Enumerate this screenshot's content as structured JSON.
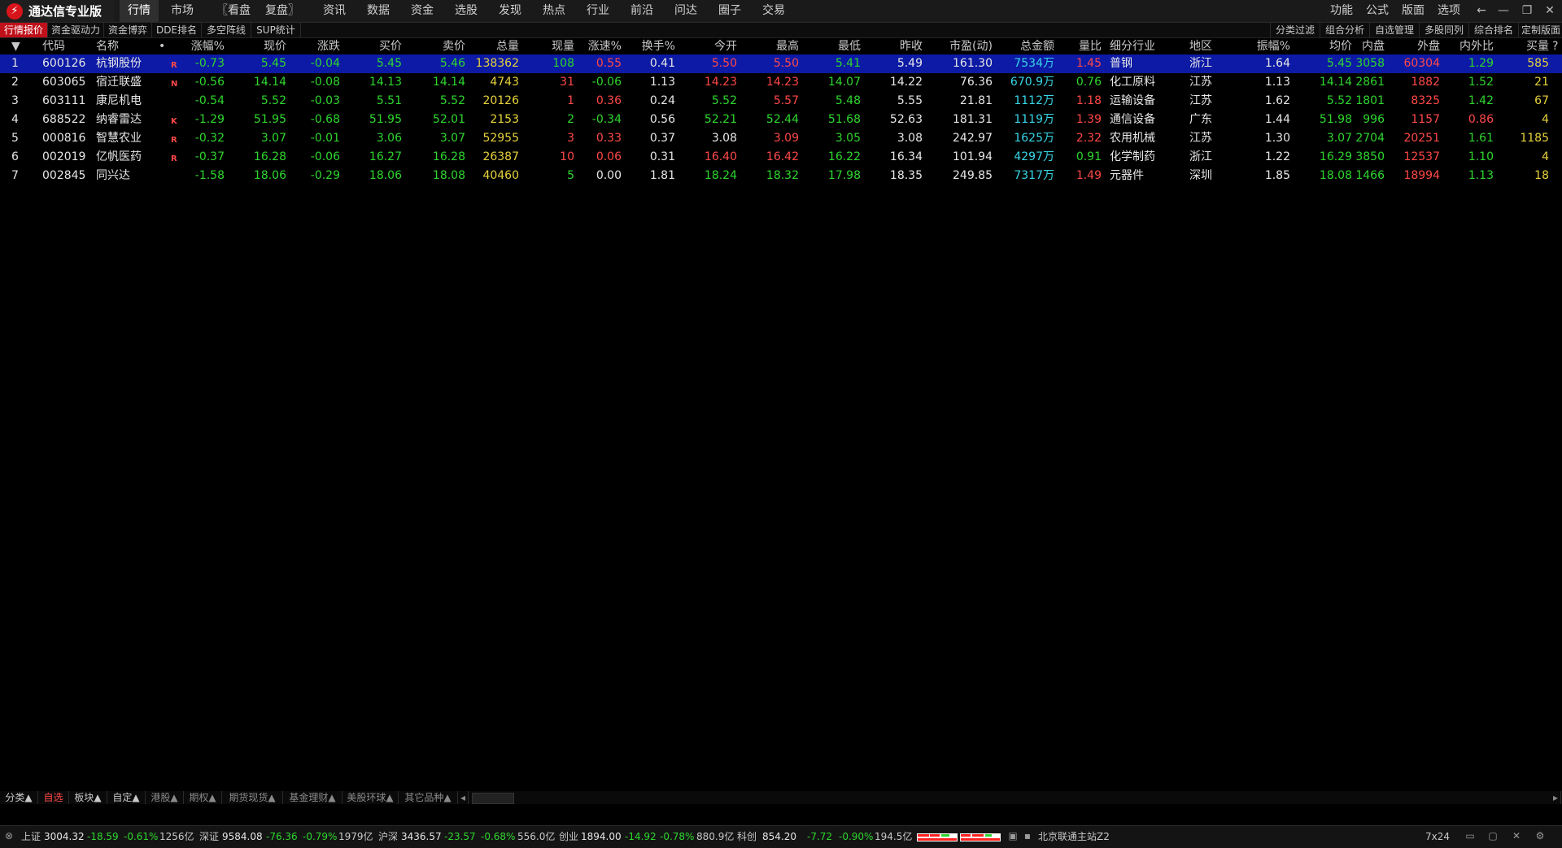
{
  "app": {
    "title": "通达信专业版"
  },
  "menu": {
    "items": [
      "行情",
      "市场",
      "〖看盘",
      "复盘〗",
      "资讯",
      "数据",
      "资金",
      "选股",
      "发现",
      "热点",
      "行业",
      "前沿",
      "问达",
      "圈子",
      "交易"
    ],
    "right": [
      "功能",
      "公式",
      "版面",
      "选项"
    ]
  },
  "window_controls": [
    "←",
    "—",
    "❐",
    "✕"
  ],
  "subtabs": [
    "行情报价",
    "资金驱动力",
    "资金博弈",
    "DDE排名",
    "多空阵线",
    "SUP统计"
  ],
  "right_tabs": [
    "分类过滤",
    "组合分析",
    "自选管理",
    "多股同列",
    "综合排名",
    "定制版面"
  ],
  "table": {
    "sort_indicator": "▼",
    "help_icon": "?",
    "columns": [
      "代码",
      "名称",
      "•",
      "涨幅%",
      "现价",
      "涨跌",
      "买价",
      "卖价",
      "总量",
      "现量",
      "涨速%",
      "换手%",
      "今开",
      "最高",
      "最低",
      "昨收",
      "市盈(动)",
      "总金额",
      "量比",
      "细分行业",
      "地区",
      "振幅%",
      "均价",
      "内盘",
      "外盘",
      "内外比",
      "买量"
    ],
    "rows": [
      {
        "idx": "1",
        "code": "600126",
        "name": "杭钢股份",
        "tag": "R",
        "chg_pct": "-0.73",
        "price": "5.45",
        "chg": "-0.04",
        "bid": "5.45",
        "ask": "5.46",
        "vol": "138362",
        "cur_vol": "108",
        "speed": "0.55",
        "turnover": "0.41",
        "open": "5.50",
        "high": "5.50",
        "low": "5.41",
        "prev": "5.49",
        "pe": "161.30",
        "amount": "7534万",
        "vol_ratio": "1.45",
        "industry": "普钢",
        "region": "浙江",
        "amplitude": "1.64",
        "avg": "5.45",
        "inner": "3058",
        "outer": "60304",
        "io_ratio": "1.29",
        "bid_vol": "585"
      },
      {
        "idx": "2",
        "code": "603065",
        "name": "宿迁联盛",
        "tag": "N",
        "chg_pct": "-0.56",
        "price": "14.14",
        "chg": "-0.08",
        "bid": "14.13",
        "ask": "14.14",
        "vol": "4743",
        "cur_vol": "31",
        "speed": "-0.06",
        "turnover": "1.13",
        "open": "14.23",
        "high": "14.23",
        "low": "14.07",
        "prev": "14.22",
        "pe": "76.36",
        "amount": "670.9万",
        "vol_ratio": "0.76",
        "industry": "化工原料",
        "region": "江苏",
        "amplitude": "1.13",
        "avg": "14.14",
        "inner": "2861",
        "outer": "1882",
        "io_ratio": "1.52",
        "bid_vol": "21"
      },
      {
        "idx": "3",
        "code": "603111",
        "name": "康尼机电",
        "tag": "",
        "chg_pct": "-0.54",
        "price": "5.52",
        "chg": "-0.03",
        "bid": "5.51",
        "ask": "5.52",
        "vol": "20126",
        "cur_vol": "1",
        "speed": "0.36",
        "turnover": "0.24",
        "open": "5.52",
        "high": "5.57",
        "low": "5.48",
        "prev": "5.55",
        "pe": "21.81",
        "amount": "1112万",
        "vol_ratio": "1.18",
        "industry": "运输设备",
        "region": "江苏",
        "amplitude": "1.62",
        "avg": "5.52",
        "inner": "1801",
        "outer": "8325",
        "io_ratio": "1.42",
        "bid_vol": "67"
      },
      {
        "idx": "4",
        "code": "688522",
        "name": "纳睿雷达",
        "tag": "K",
        "chg_pct": "-1.29",
        "price": "51.95",
        "chg": "-0.68",
        "bid": "51.95",
        "ask": "52.01",
        "vol": "2153",
        "cur_vol": "2",
        "speed": "-0.34",
        "turnover": "0.56",
        "open": "52.21",
        "high": "52.44",
        "low": "51.68",
        "prev": "52.63",
        "pe": "181.31",
        "amount": "1119万",
        "vol_ratio": "1.39",
        "industry": "通信设备",
        "region": "广东",
        "amplitude": "1.44",
        "avg": "51.98",
        "inner": "996",
        "outer": "1157",
        "io_ratio": "0.86",
        "bid_vol": "4"
      },
      {
        "idx": "5",
        "code": "000816",
        "name": "智慧农业",
        "tag": "R",
        "chg_pct": "-0.32",
        "price": "3.07",
        "chg": "-0.01",
        "bid": "3.06",
        "ask": "3.07",
        "vol": "52955",
        "cur_vol": "3",
        "speed": "0.33",
        "turnover": "0.37",
        "open": "3.08",
        "high": "3.09",
        "low": "3.05",
        "prev": "3.08",
        "pe": "242.97",
        "amount": "1625万",
        "vol_ratio": "2.32",
        "industry": "农用机械",
        "region": "江苏",
        "amplitude": "1.30",
        "avg": "3.07",
        "inner": "2704",
        "outer": "20251",
        "io_ratio": "1.61",
        "bid_vol": "1185"
      },
      {
        "idx": "6",
        "code": "002019",
        "name": "亿帆医药",
        "tag": "R",
        "chg_pct": "-0.37",
        "price": "16.28",
        "chg": "-0.06",
        "bid": "16.27",
        "ask": "16.28",
        "vol": "26387",
        "cur_vol": "10",
        "speed": "0.06",
        "turnover": "0.31",
        "open": "16.40",
        "high": "16.42",
        "low": "16.22",
        "prev": "16.34",
        "pe": "101.94",
        "amount": "4297万",
        "vol_ratio": "0.91",
        "industry": "化学制药",
        "region": "浙江",
        "amplitude": "1.22",
        "avg": "16.29",
        "inner": "3850",
        "outer": "12537",
        "io_ratio": "1.10",
        "bid_vol": "4"
      },
      {
        "idx": "7",
        "code": "002845",
        "name": "同兴达",
        "tag": "",
        "chg_pct": "-1.58",
        "price": "18.06",
        "chg": "-0.29",
        "bid": "18.06",
        "ask": "18.08",
        "vol": "40460",
        "cur_vol": "5",
        "speed": "0.00",
        "turnover": "1.81",
        "open": "18.24",
        "high": "18.32",
        "low": "17.98",
        "prev": "18.35",
        "pe": "249.85",
        "amount": "7317万",
        "vol_ratio": "1.49",
        "industry": "元器件",
        "region": "深圳",
        "amplitude": "1.85",
        "avg": "18.08",
        "inner": "1466",
        "outer": "18994",
        "io_ratio": "1.13",
        "bid_vol": "18"
      }
    ]
  },
  "category_tabs": [
    "分类▲",
    "自选",
    "板块▲",
    "自定▲",
    "港股▲",
    "期权▲",
    "期货现货▲",
    "基金理财▲",
    "美股环球▲",
    "其它品种▲"
  ],
  "scroll_left": "◂",
  "scroll_right": "▸",
  "status": {
    "indices": [
      {
        "name": "上证",
        "value": "3004.32",
        "chg": "-18.59",
        "pct": "-0.61%",
        "amount": "1256亿"
      },
      {
        "name": "深证",
        "value": "9584.08",
        "chg": "-76.36",
        "pct": "-0.79%",
        "amount": "1979亿"
      },
      {
        "name": "沪深",
        "value": "3436.57",
        "chg": "-23.57",
        "pct": "-0.68%",
        "amount": "556.0亿"
      },
      {
        "name": "创业",
        "value": "1894.00",
        "chg": "-14.92",
        "pct": "-0.78%",
        "amount": "880.9亿"
      },
      {
        "name": "科创",
        "value": "854.20",
        "chg": "-7.72",
        "pct": "-0.90%",
        "amount": "194.5亿"
      }
    ],
    "server": "北京联通主站Z2",
    "session": "7x24"
  },
  "colors": {
    "up": "#ff4848",
    "down": "#2ed62e",
    "selected_row": "#0c1aa5",
    "accent": "#c0101a"
  }
}
